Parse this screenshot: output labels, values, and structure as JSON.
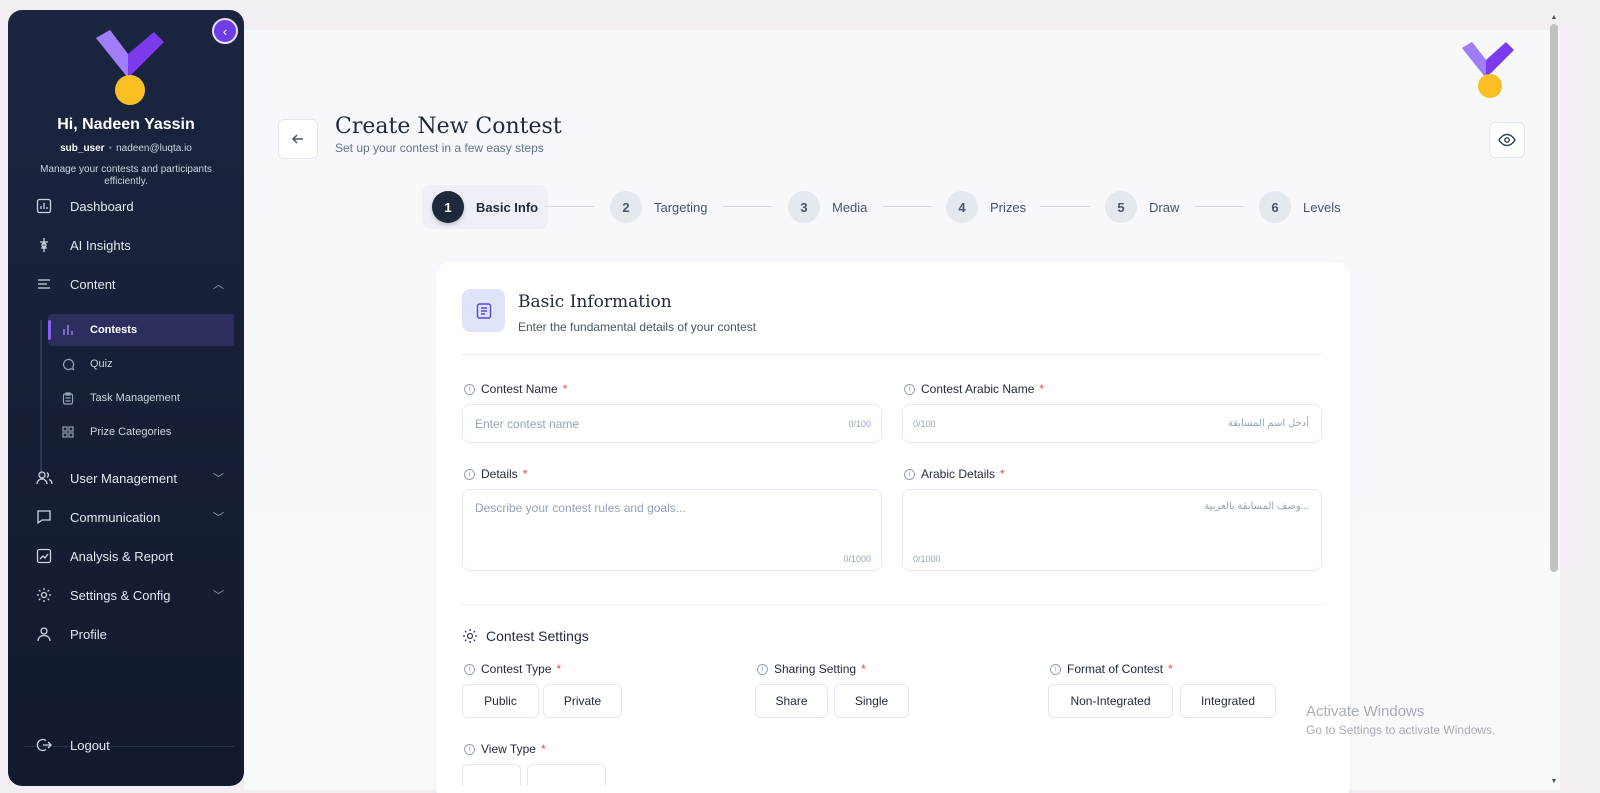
{
  "sidebar": {
    "greeting": "Hi, Nadeen Yassin",
    "role": "sub_user",
    "email": "nadeen@luqta.io",
    "description": "Manage your contests and participants efficiently.",
    "items": [
      {
        "label": "Dashboard"
      },
      {
        "label": "AI Insights"
      },
      {
        "label": "Content"
      },
      {
        "label": "User Management"
      },
      {
        "label": "Communication"
      },
      {
        "label": "Analysis & Report"
      },
      {
        "label": "Settings & Config"
      },
      {
        "label": "Profile"
      }
    ],
    "content_sub": [
      {
        "label": "Contests"
      },
      {
        "label": "Quiz"
      },
      {
        "label": "Task Management"
      },
      {
        "label": "Prize Categories"
      }
    ],
    "logout": "Logout"
  },
  "header": {
    "title": "Create New Contest",
    "subtitle": "Set up your contest in a few easy steps"
  },
  "steps": [
    {
      "num": "1",
      "label": "Basic Info"
    },
    {
      "num": "2",
      "label": "Targeting"
    },
    {
      "num": "3",
      "label": "Media"
    },
    {
      "num": "4",
      "label": "Prizes"
    },
    {
      "num": "5",
      "label": "Draw"
    },
    {
      "num": "6",
      "label": "Levels"
    }
  ],
  "card": {
    "title": "Basic Information",
    "subtitle": "Enter the fundamental details of your contest",
    "contest_name": {
      "label": "Contest Name",
      "placeholder": "Enter contest name",
      "counter": "0/100"
    },
    "contest_arabic_name": {
      "label": "Contest Arabic Name",
      "placeholder": "أدخل اسم المسابقة",
      "counter": "0/100"
    },
    "details": {
      "label": "Details",
      "placeholder": "Describe your contest rules and goals...",
      "counter": "0/1000"
    },
    "arabic_details": {
      "label": "Arabic Details",
      "placeholder": "وصف المسابقة بالعربية...",
      "counter": "0/1000"
    },
    "settings_title": "Contest Settings",
    "contest_type": {
      "label": "Contest Type",
      "options": [
        "Public",
        "Private"
      ]
    },
    "sharing_setting": {
      "label": "Sharing Setting",
      "options": [
        "Share",
        "Single"
      ]
    },
    "format": {
      "label": "Format of Contest",
      "options": [
        "Non-Integrated",
        "Integrated"
      ]
    },
    "view_type": {
      "label": "View Type"
    },
    "required_mark": "*"
  },
  "watermark": {
    "line1": "Activate Windows",
    "line2": "Go to Settings to activate Windows."
  },
  "colors": {
    "accent": "#6d3ee8",
    "sidebar_bg": "#151f36",
    "required": "#ef4444",
    "logo_purple": "#7c3aed",
    "logo_yellow": "#fbbf24"
  }
}
